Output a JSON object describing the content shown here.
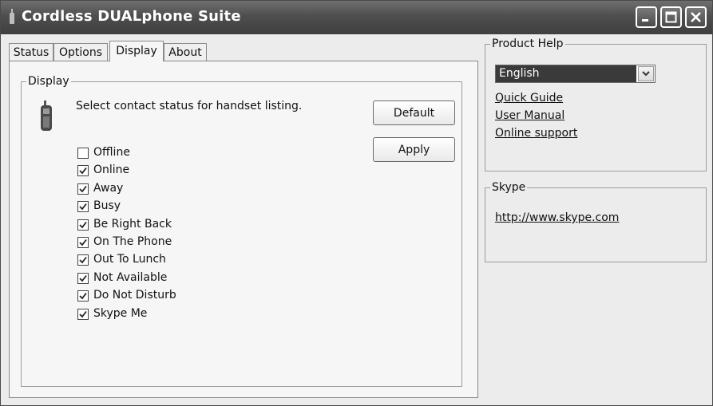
{
  "window": {
    "title": "Cordless DUALphone Suite",
    "controls": [
      "minimize-icon",
      "maximize-icon",
      "close-icon"
    ]
  },
  "tabs": [
    {
      "label": "Status"
    },
    {
      "label": "Options"
    },
    {
      "label": "Display",
      "active": true
    },
    {
      "label": "About"
    }
  ],
  "display": {
    "group_label": "Display",
    "instruction": "Select contact status for handset listing.",
    "default_label": "Default",
    "apply_label": "Apply",
    "statuses": [
      {
        "label": "Offline",
        "checked": false
      },
      {
        "label": "Online",
        "checked": true
      },
      {
        "label": "Away",
        "checked": true
      },
      {
        "label": "Busy",
        "checked": true
      },
      {
        "label": "Be Right Back",
        "checked": true
      },
      {
        "label": "On The Phone",
        "checked": true
      },
      {
        "label": "Out To Lunch",
        "checked": true
      },
      {
        "label": "Not Available",
        "checked": true
      },
      {
        "label": "Do Not Disturb",
        "checked": true
      },
      {
        "label": "Skype Me",
        "checked": true
      }
    ]
  },
  "product_help": {
    "group_label": "Product Help",
    "language": "English",
    "links": [
      "Quick Guide",
      "User Manual",
      "Online support"
    ]
  },
  "skype": {
    "group_label": "Skype",
    "link": "http://www.skype.com"
  }
}
